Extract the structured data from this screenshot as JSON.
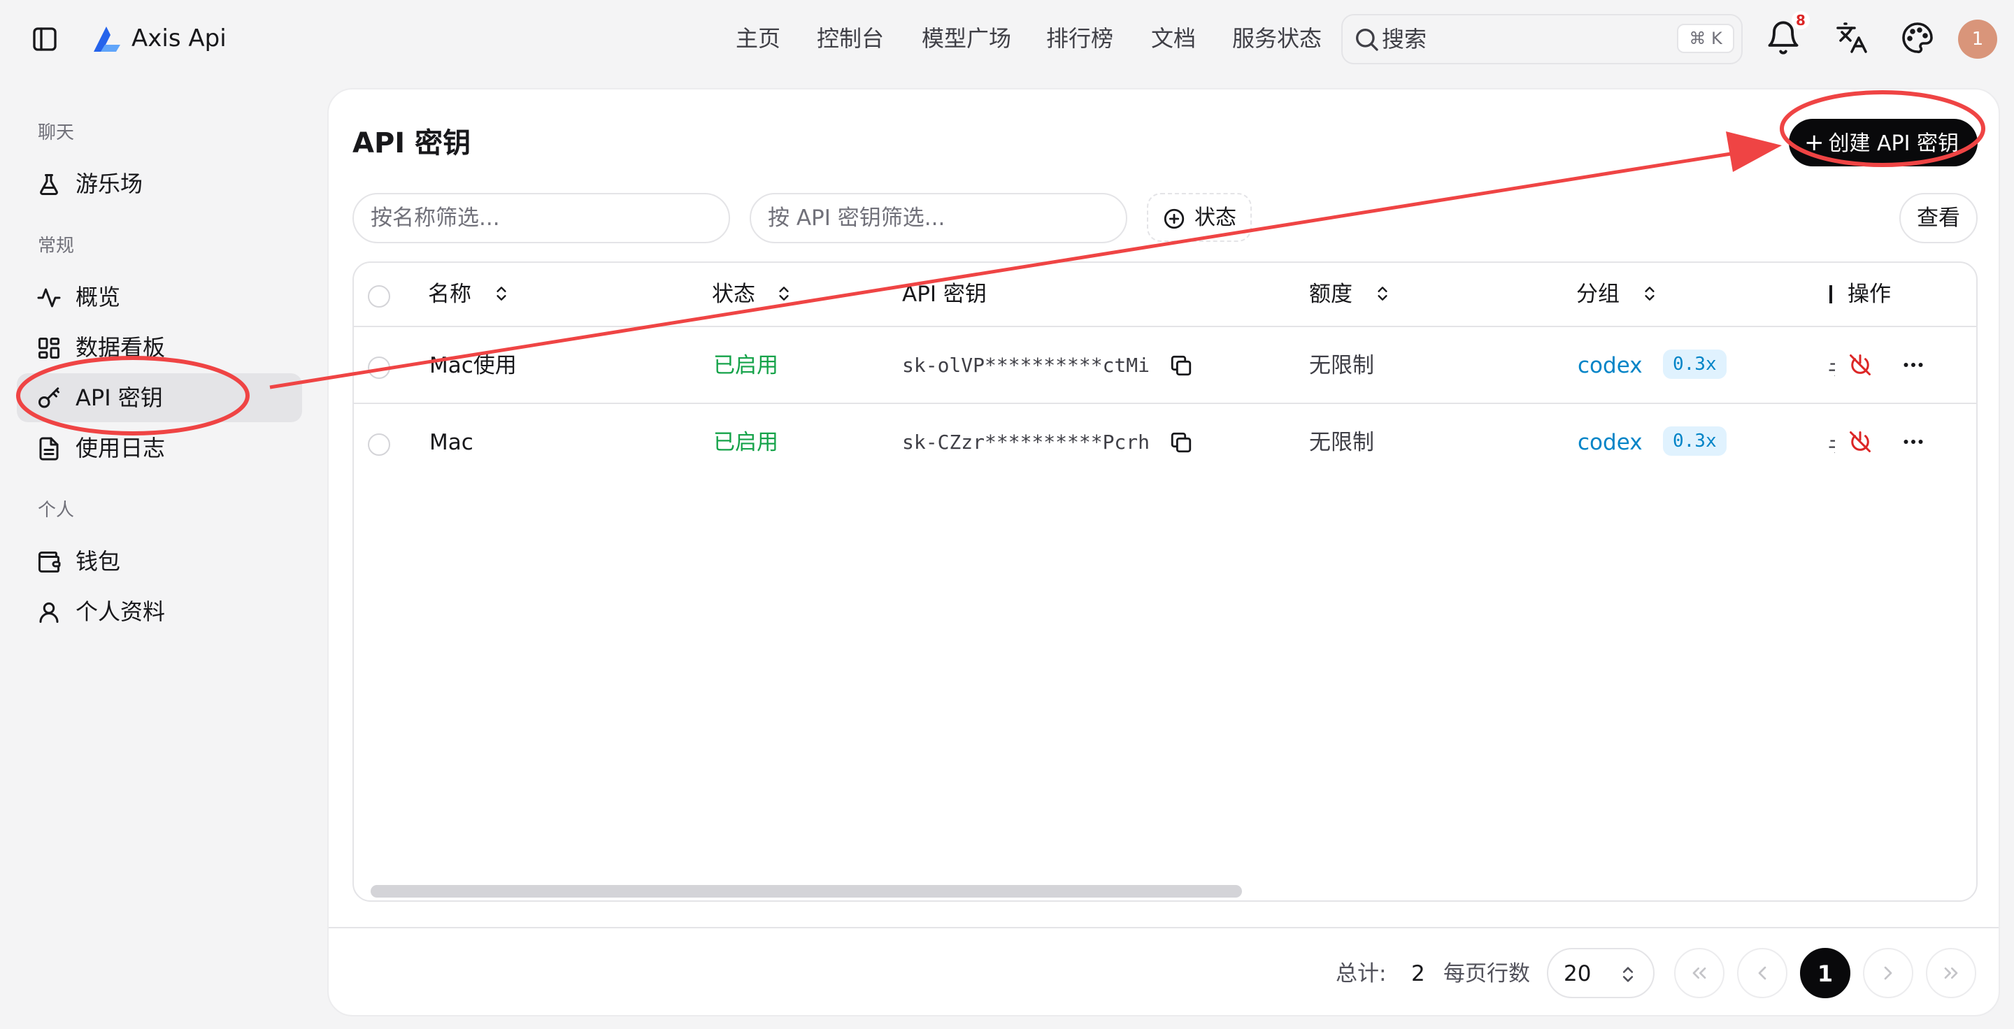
{
  "header": {
    "app_title": "Axis Api",
    "nav": [
      "主页",
      "控制台",
      "模型广场",
      "排行榜",
      "文档",
      "服务状态"
    ],
    "search_placeholder": "搜索",
    "search_shortcut": "⌘ K",
    "notification_count": "8",
    "avatar_initial": "1"
  },
  "sidebar": {
    "sections": [
      {
        "title": "聊天",
        "items": [
          {
            "label": "游乐场",
            "icon": "flask-icon"
          }
        ]
      },
      {
        "title": "常规",
        "items": [
          {
            "label": "概览",
            "icon": "activity-icon"
          },
          {
            "label": "数据看板",
            "icon": "dashboard-icon"
          },
          {
            "label": "API 密钥",
            "icon": "key-icon",
            "active": true
          },
          {
            "label": "使用日志",
            "icon": "document-icon"
          }
        ]
      },
      {
        "title": "个人",
        "items": [
          {
            "label": "钱包",
            "icon": "wallet-icon"
          },
          {
            "label": "个人资料",
            "icon": "user-icon"
          }
        ]
      }
    ]
  },
  "main": {
    "title": "API 密钥",
    "create_button": "创建 API 密钥",
    "filter_name_placeholder": "按名称筛选...",
    "filter_key_placeholder": "按 API 密钥筛选...",
    "status_filter": "状态",
    "view_button": "查看",
    "table": {
      "columns": [
        "名称",
        "状态",
        "API 密钥",
        "额度",
        "分组",
        "操作"
      ],
      "rows": [
        {
          "name": "Mac使用",
          "status": "已启用",
          "key": "sk-olVP**********ctMi",
          "quota": "无限制",
          "group": "codex",
          "multiplier": "0.3x"
        },
        {
          "name": "Mac",
          "status": "已启用",
          "key": "sk-CZzr**********Pcrh",
          "quota": "无限制",
          "group": "codex",
          "multiplier": "0.3x"
        }
      ]
    },
    "pagination": {
      "total_label": "总计:",
      "total": "2",
      "rows_per_page_label": "每页行数",
      "rows_per_page": "20",
      "current_page": "1"
    }
  },
  "colors": {
    "accent": "#09090b",
    "status_enabled": "#16a34a",
    "group_link": "#0284c7",
    "annotation": "#ef4444"
  }
}
